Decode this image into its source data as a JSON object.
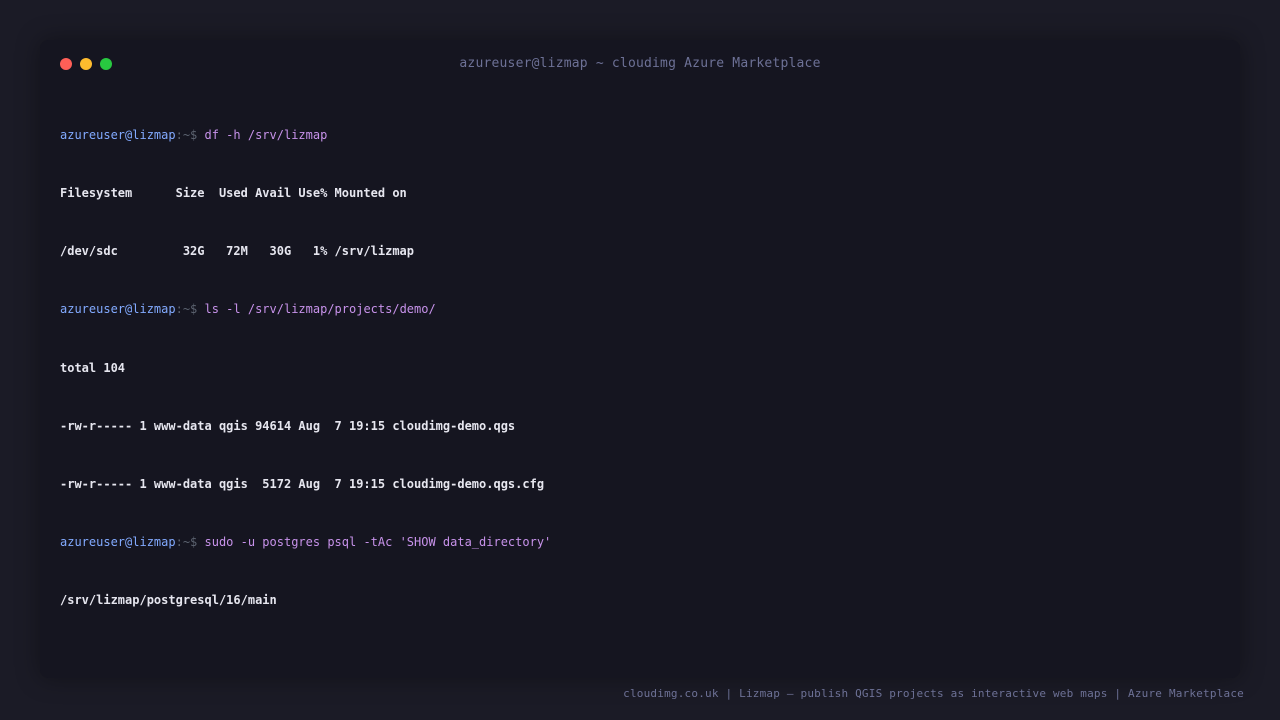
{
  "window": {
    "title": "azureuser@lizmap ~ cloudimg Azure Marketplace"
  },
  "prompt": {
    "user": "azureuser@lizmap",
    "path": ":~$ "
  },
  "terminal": {
    "lines": [
      {
        "type": "cmd",
        "text": "df -h /srv/lizmap"
      },
      {
        "type": "out",
        "text": "Filesystem      Size  Used Avail Use% Mounted on"
      },
      {
        "type": "out",
        "text": "/dev/sdc         32G   72M   30G   1% /srv/lizmap"
      },
      {
        "type": "cmd",
        "text": "ls -l /srv/lizmap/projects/demo/"
      },
      {
        "type": "out",
        "text": "total 104"
      },
      {
        "type": "out",
        "text": "-rw-r----- 1 www-data qgis 94614 Aug  7 19:15 cloudimg-demo.qgs"
      },
      {
        "type": "out",
        "text": "-rw-r----- 1 www-data qgis  5172 Aug  7 19:15 cloudimg-demo.qgs.cfg"
      },
      {
        "type": "cmd",
        "text": "sudo -u postgres psql -tAc 'SHOW data_directory'"
      },
      {
        "type": "out",
        "text": "/srv/lizmap/postgresql/16/main"
      }
    ]
  },
  "footer": {
    "text": "cloudimg.co.uk | Lizmap — publish QGIS projects as interactive web maps | Azure Marketplace"
  },
  "colors": {
    "close": "#ff5f57",
    "minimize": "#febc2e",
    "maximize": "#28c840",
    "prompt_user": "#82aaff",
    "command": "#c792ea"
  }
}
